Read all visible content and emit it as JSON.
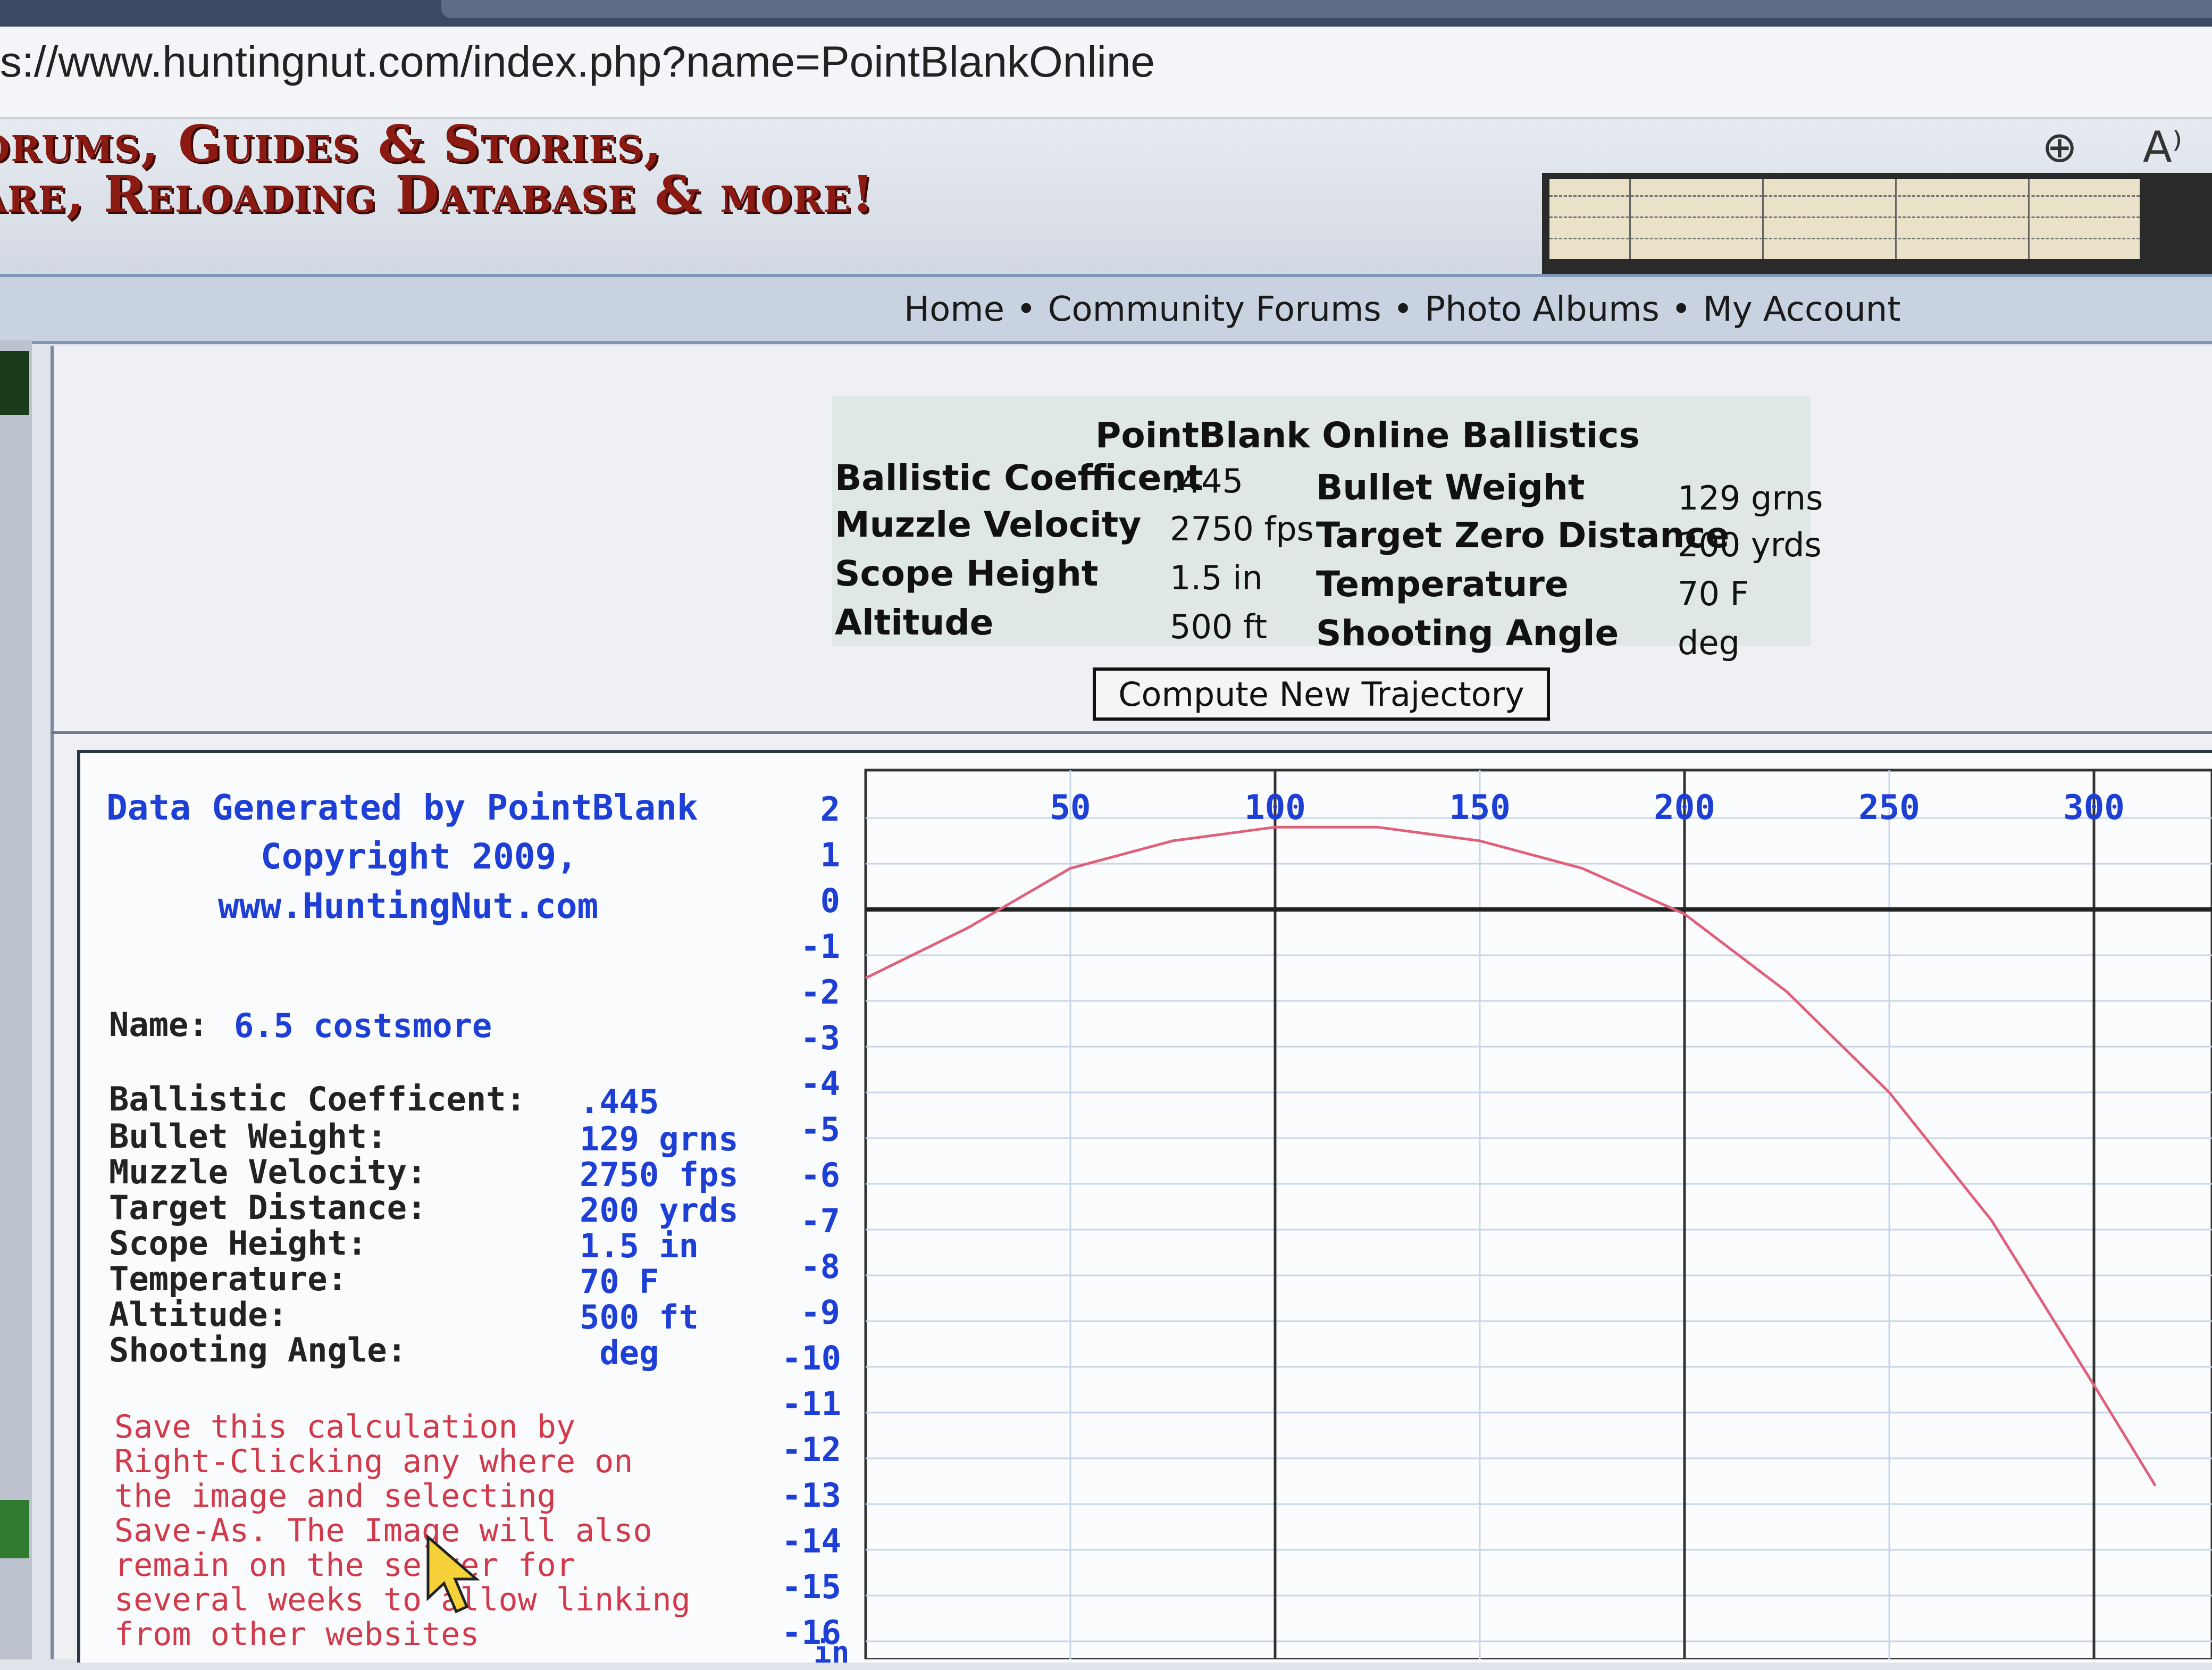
{
  "browser": {
    "url": "s://www.huntingnut.com/index.php?name=PointBlankOnline",
    "icons": [
      "zoom-icon",
      "read-aloud-icon"
    ],
    "zoom_glyph": "⊕",
    "read_aloud_glyph": "A⁾"
  },
  "banner": {
    "line1": "orums, Guides & Stories,",
    "line2": "are, Reloading Database & more!"
  },
  "nav": {
    "items": [
      "Home",
      "Community Forums",
      "Photo Albums",
      "My Account"
    ],
    "separator": "•"
  },
  "calculator": {
    "title": "PointBlank Online Ballistics",
    "left": [
      {
        "label": "Ballistic Coefficent",
        "value": ".445"
      },
      {
        "label": "Muzzle Velocity",
        "value": "2750 fps"
      },
      {
        "label": "Scope Height",
        "value": "1.5 in"
      },
      {
        "label": "Altitude",
        "value": "500 ft"
      }
    ],
    "right": [
      {
        "label": "Bullet Weight",
        "value": "129 grns"
      },
      {
        "label": "Target Zero Distance",
        "value": "200 yrds"
      },
      {
        "label": "Temperature",
        "value": "70 F"
      },
      {
        "label": "Shooting Angle",
        "value": "deg"
      }
    ],
    "compute_button": "Compute New Trajectory"
  },
  "report": {
    "header": [
      "Data Generated by PointBlank",
      "Copyright 2009,",
      "www.HuntingNut.com"
    ],
    "name_label": "Name:",
    "name_value": "6.5 costsmore",
    "bc_label": "Ballistic Coefficent:",
    "bc_value": ".445",
    "rows": [
      {
        "label": "Bullet Weight:",
        "value": "129 grns"
      },
      {
        "label": "Muzzle Velocity:",
        "value": "2750 fps"
      },
      {
        "label": "Target Distance:",
        "value": "200 yrds"
      },
      {
        "label": "Scope Height:",
        "value": "1.5 in"
      },
      {
        "label": "Temperature:",
        "value": "70 F"
      },
      {
        "label": "Altitude:",
        "value": "500 ft"
      },
      {
        "label": "Shooting Angle:",
        "value": " deg"
      }
    ],
    "note": [
      "Save this calculation by",
      "Right-Clicking any where on",
      "the image and selecting",
      "Save-As. The Image will also",
      "remain on the server for",
      "several weeks to allow linking",
      "from other websites"
    ],
    "note_color": "#d13a4a",
    "text_color": "#1d3fd6"
  },
  "chart_data": {
    "type": "line",
    "x_tick_labels": [
      "50",
      "100",
      "150",
      "200",
      "250",
      "300"
    ],
    "y_tick_labels": [
      "2",
      "1",
      "0",
      "-1",
      "-2",
      "-3",
      "-4",
      "-5",
      "-6",
      "-7",
      "-8",
      "-9",
      "-10",
      "-11",
      "-12",
      "-13",
      "-14",
      "-15",
      "-16"
    ],
    "y_unit": "in",
    "xlim": [
      0,
      325
    ],
    "ylim": [
      -16,
      2
    ],
    "series": [
      {
        "color": "#e0607a",
        "x": [
          0,
          25,
          50,
          75,
          100,
          125,
          150,
          175,
          200,
          225,
          250,
          275,
          300,
          315
        ],
        "y": [
          -1.5,
          -0.4,
          0.9,
          1.5,
          1.8,
          1.8,
          1.5,
          0.9,
          -0.1,
          -1.8,
          -4.0,
          -6.8,
          -10.4,
          -12.6
        ]
      }
    ],
    "zero_line": 0,
    "bold_verticals": [
      100,
      200,
      300
    ]
  }
}
